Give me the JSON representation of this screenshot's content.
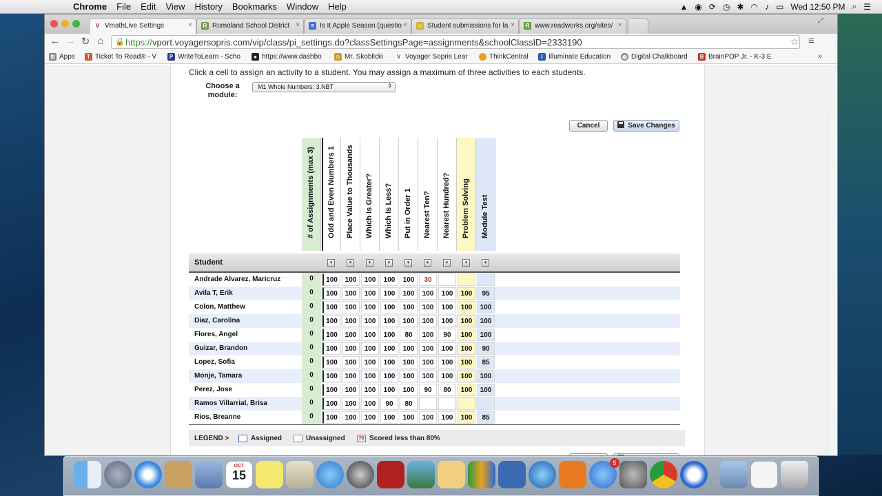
{
  "menubar": {
    "app": "Chrome",
    "menus": [
      "File",
      "Edit",
      "View",
      "History",
      "Bookmarks",
      "Window",
      "Help"
    ],
    "clock": "Wed 12:50 PM"
  },
  "tabs": [
    {
      "title": "VmathLive Settings",
      "active": true
    },
    {
      "title": "Romoland School District",
      "active": false
    },
    {
      "title": "Is It Apple Season (questio",
      "active": false
    },
    {
      "title": "Student submissions for la",
      "active": false
    },
    {
      "title": "www.readworks.org/sites/",
      "active": false
    }
  ],
  "address": {
    "scheme": "https://",
    "rest": "vport.voyagersopris.com/vip/class/pi_settings.do?classSettingsPage=assignments&schoolClassID=2333190"
  },
  "bookmarks": [
    "Apps",
    "Ticket To Read® - V",
    "WriteToLearn - Scho",
    "https://www.dashbo",
    "Mr. Skoblicki",
    "Voyager Sopris Lear",
    "ThinkCentral",
    "Illuminate Education",
    "Digital Chalkboard",
    "BrainPOP Jr. - K-3 E"
  ],
  "page": {
    "instructions": "Click a cell to assign an activity to a student. You may assign a maximum of three activities to each students.",
    "module_label": "Choose a module:",
    "module_value": "M1 Whole Numbers: 3.NBT",
    "cancel": "Cancel",
    "save": "Save Changes",
    "student_header": "Student",
    "columns": [
      "# of Assignments (max 3)",
      "Odd and Even Numbers 1",
      "Place Value to Thousands",
      "Which Is Greater?",
      "Which Is Less?",
      "Put in Order 1",
      "Nearest Ten?",
      "Nearest Hundred?",
      "Problem Solving",
      "Module Test"
    ],
    "rows": [
      {
        "name": "Andrade Alvarez, Maricruz",
        "count": "0",
        "scores": [
          "100",
          "100",
          "100",
          "100",
          "100",
          "30",
          "",
          "",
          ""
        ]
      },
      {
        "name": "Avila T, Erik",
        "count": "0",
        "scores": [
          "100",
          "100",
          "100",
          "100",
          "100",
          "100",
          "100",
          "100",
          "95"
        ]
      },
      {
        "name": "Colon, Matthew",
        "count": "0",
        "scores": [
          "100",
          "100",
          "100",
          "100",
          "100",
          "100",
          "100",
          "100",
          "100"
        ]
      },
      {
        "name": "Diaz, Carolina",
        "count": "0",
        "scores": [
          "100",
          "100",
          "100",
          "100",
          "100",
          "100",
          "100",
          "100",
          "100"
        ]
      },
      {
        "name": "Flores, Angel",
        "count": "0",
        "scores": [
          "100",
          "100",
          "100",
          "100",
          "80",
          "100",
          "90",
          "100",
          "100"
        ]
      },
      {
        "name": "Guizar, Brandon",
        "count": "0",
        "scores": [
          "100",
          "100",
          "100",
          "100",
          "100",
          "100",
          "100",
          "100",
          "90"
        ]
      },
      {
        "name": "Lopez, Sofia",
        "count": "0",
        "scores": [
          "100",
          "100",
          "100",
          "100",
          "100",
          "100",
          "100",
          "100",
          "85"
        ]
      },
      {
        "name": "Monje, Tamara",
        "count": "0",
        "scores": [
          "100",
          "100",
          "100",
          "100",
          "100",
          "100",
          "100",
          "100",
          "100"
        ]
      },
      {
        "name": "Perez, Jose",
        "count": "0",
        "scores": [
          "100",
          "100",
          "100",
          "100",
          "100",
          "90",
          "80",
          "100",
          "100"
        ]
      },
      {
        "name": "Ramos Villarrial, Brisa",
        "count": "0",
        "scores": [
          "100",
          "100",
          "100",
          "90",
          "80",
          "",
          "",
          "",
          ""
        ]
      },
      {
        "name": "Rios, Breanne",
        "count": "0",
        "scores": [
          "100",
          "100",
          "100",
          "100",
          "100",
          "100",
          "100",
          "100",
          "85"
        ]
      }
    ],
    "legend": {
      "title": "LEGEND >",
      "assigned": "Assigned",
      "unassigned": "Unassigned",
      "low_example": "70",
      "low_label": "Scored less than 80%"
    }
  },
  "dock": {
    "calendar_day": "15",
    "calendar_month": "OCT",
    "app_store_badge": "5"
  },
  "colors": {
    "count_column": "#d8ecd2",
    "problem_solving": "#fdf7c3",
    "module_test": "#dde7f8",
    "row_alt": "#e8eefb",
    "low_score_text": "#b03030"
  }
}
